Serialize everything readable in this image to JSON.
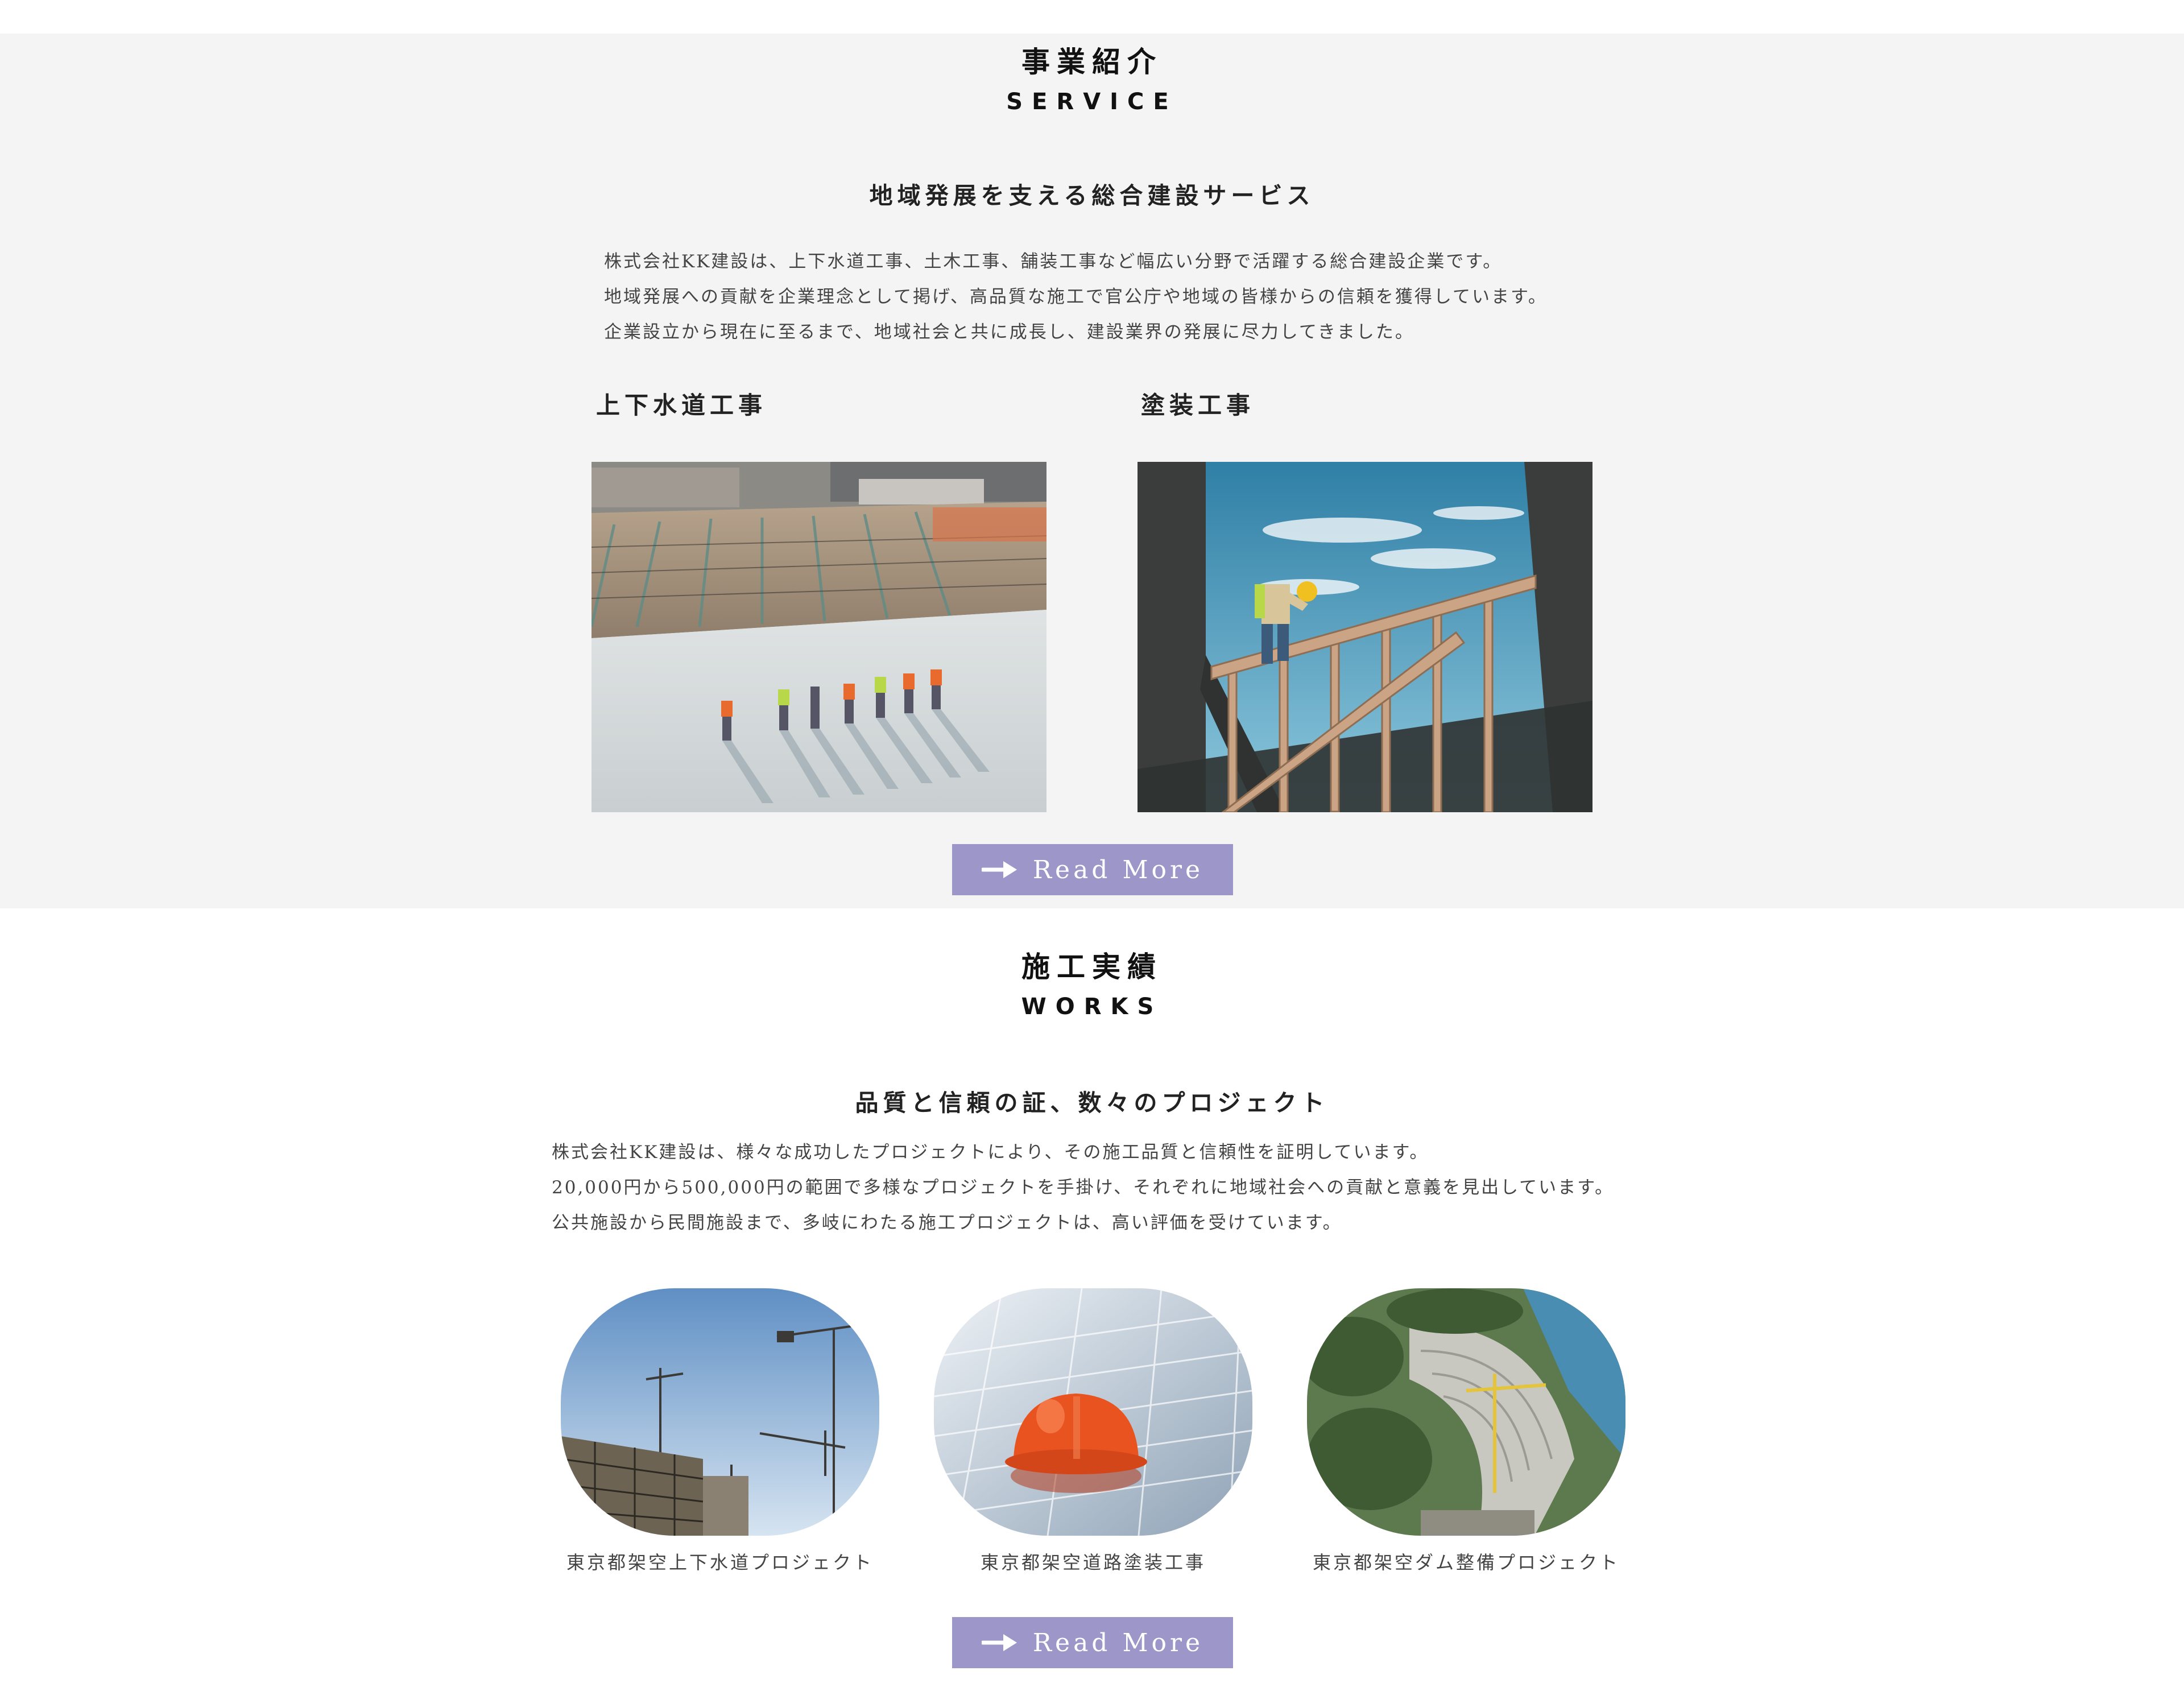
{
  "service": {
    "title": "事業紹介",
    "subtitle": "SERVICE",
    "lead": "地域発展を支える総合建設サービス",
    "paragraphs": [
      "株式会社KK建設は、上下水道工事、土木工事、舗装工事など幅広い分野で活躍する総合建設企業です。",
      "地域発展への貢献を企業理念として掲げ、高品質な施工で官公庁や地域の皆様からの信頼を獲得しています。",
      "企業設立から現在に至るまで、地域社会と共に成長し、建設業界の発展に尽力してきました。"
    ],
    "items": [
      {
        "heading": "上下水道工事",
        "image_icon": "construction-site-photo"
      },
      {
        "heading": "塗装工事",
        "image_icon": "worker-on-frame-photo"
      }
    ],
    "read_more": "Read More"
  },
  "works": {
    "title": "施工実績",
    "subtitle": "WORKS",
    "lead": "品質と信頼の証、数々のプロジェクト",
    "paragraphs": [
      "株式会社KK建設は、様々な成功したプロジェクトにより、その施工品質と信頼性を証明しています。",
      "20,000円から500,000円の範囲で多様なプロジェクトを手掛け、それぞれに地域社会への貢献と意義を見出しています。",
      "公共施設から民間施設まで、多岐にわたる施工プロジェクトは、高い評価を受けています。"
    ],
    "projects": [
      {
        "caption": "東京都架空上下水道プロジェクト",
        "image_icon": "cranes-photo"
      },
      {
        "caption": "東京都架空道路塗装工事",
        "image_icon": "hardhat-solar-photo"
      },
      {
        "caption": "東京都架空ダム整備プロジェクト",
        "image_icon": "dam-photo"
      }
    ],
    "read_more": "Read More"
  },
  "colors": {
    "section_bg": "#f4f4f4",
    "button_bg": "#9c97c8",
    "button_text": "#ffffff"
  }
}
